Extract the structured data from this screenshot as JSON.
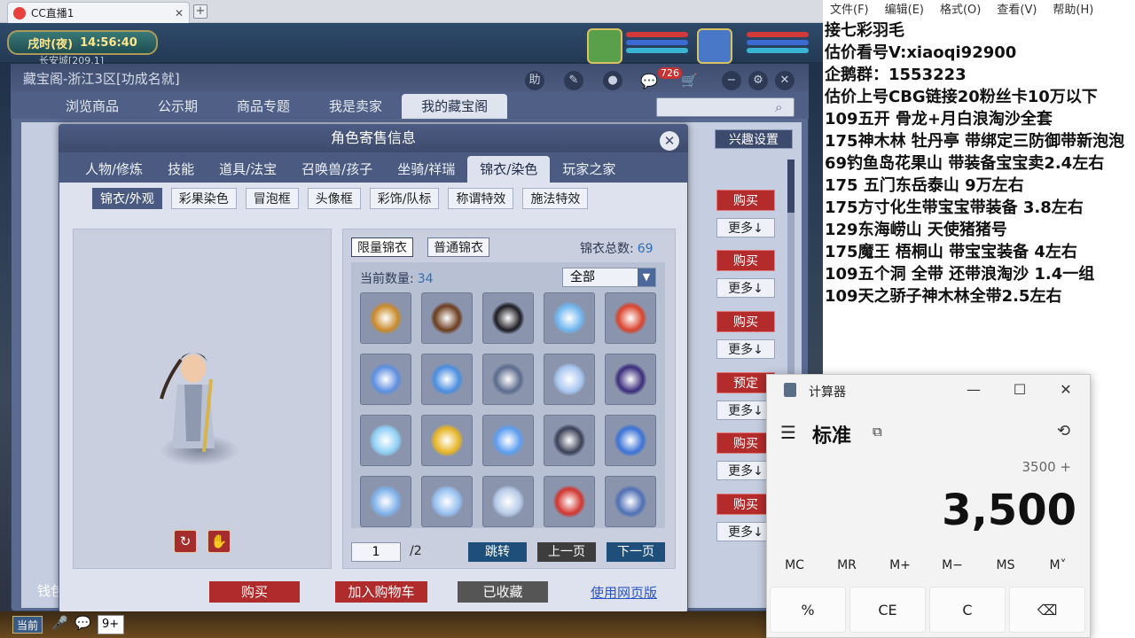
{
  "browser": {
    "tab_title": "CC直播1",
    "tab_close": "✕",
    "new_tab": "+"
  },
  "game": {
    "clock_period": "戌时(夜)",
    "clock_time": "14:56:40",
    "location": "长安城[209,1]",
    "chat_channel": "当前",
    "chat_input": "9+"
  },
  "store": {
    "title": "藏宝阁-浙江3区[功成名就]",
    "toolbar_help": "助",
    "cart_count": "726",
    "nav_tabs": [
      "浏览商品",
      "公示期",
      "商品专题",
      "我是卖家",
      "我的藏宝阁"
    ],
    "active_nav": "我的藏宝阁",
    "interest_label": "兴趣设置",
    "side_buttons": [
      {
        "action": "购买",
        "more": "更多↓"
      },
      {
        "action": "购买",
        "more": "更多↓"
      },
      {
        "action": "购买",
        "more": "更多↓"
      },
      {
        "action": "预定",
        "more": "更多↓"
      },
      {
        "action": "购买",
        "more": "更多↓"
      },
      {
        "action": "购买",
        "more": "更多↓"
      }
    ],
    "wallet_label": "钱包"
  },
  "modal": {
    "title": "角色寄售信息",
    "tabs": [
      "人物/修炼",
      "技能",
      "道具/法宝",
      "召唤兽/孩子",
      "坐骑/祥瑞",
      "锦衣/染色",
      "玩家之家"
    ],
    "active_tab": "锦衣/染色",
    "subtabs": [
      "锦衣/外观",
      "彩果染色",
      "冒泡框",
      "头像框",
      "彩饰/队标",
      "称谓特效",
      "施法特效"
    ],
    "active_subtab": "锦衣/外观",
    "kind_limited": "限量锦衣",
    "kind_normal": "普通锦衣",
    "total_label": "锦衣总数:",
    "total_value": "69",
    "current_label": "当前数量:",
    "current_value": "34",
    "filter_value": "全部",
    "page_current": "1",
    "page_total": "/2",
    "jump_label": "跳转",
    "prev_label": "上一页",
    "next_label": "下一页",
    "buy_label": "购买",
    "cart_label": "加入购物车",
    "fav_label": "已收藏",
    "web_label": "使用网页版",
    "items": [
      {
        "name": "staff-item",
        "color": "#c98a2a"
      },
      {
        "name": "hair-ornament-item",
        "color": "#6b3b1c"
      },
      {
        "name": "black-hair-item",
        "color": "#1b1b22"
      },
      {
        "name": "blue-aura-item",
        "color": "#6fb6ef"
      },
      {
        "name": "red-lantern-item",
        "color": "#d9432b"
      },
      {
        "name": "cloud-item",
        "color": "#5d8fe0"
      },
      {
        "name": "swirl-item",
        "color": "#4a8de0"
      },
      {
        "name": "dark-wing-item",
        "color": "#5b6a8c"
      },
      {
        "name": "ice-crystal-item",
        "color": "#a9c7f0"
      },
      {
        "name": "portrait-card-item",
        "color": "#3a2c7a"
      },
      {
        "name": "ice-wing-item",
        "color": "#8fd0f5"
      },
      {
        "name": "golden-orb-item",
        "color": "#e7b424"
      },
      {
        "name": "sparkle-item",
        "color": "#5d9ef0"
      },
      {
        "name": "dark-rider-item",
        "color": "#3a3f55"
      },
      {
        "name": "blue-ribbon-item",
        "color": "#3a72d6"
      },
      {
        "name": "mist-item",
        "color": "#7fb2ea"
      },
      {
        "name": "nebula-item",
        "color": "#96c0f0"
      },
      {
        "name": "ring-item",
        "color": "#b7cbe8"
      },
      {
        "name": "red-robe-item",
        "color": "#d2352e"
      },
      {
        "name": "blue-armor-item",
        "color": "#4f6fb5"
      }
    ]
  },
  "notepad": {
    "menu": [
      "文件(F)",
      "编辑(E)",
      "格式(O)",
      "查看(V)",
      "帮助(H)"
    ],
    "lines": [
      "  接七彩羽毛",
      "估价看号V:xiaoqi92900",
      "企鹅群：1553223",
      "估价上号CBG链接20粉丝卡10万以下",
      "109五开 骨龙+月白浪淘沙全套",
      "175神木林 牡丹亭  带绑定三防御带新泡泡",
      "69钓鱼岛花果山 带装备宝宝卖2.4左右",
      "175 五门东岳泰山  9万左右",
      "175方寸化生带宝宝带装备  3.8左右",
      "129东海崂山 天使猪猪号",
      "175魔王 梧桐山  带宝宝装备 4左右",
      "109五个洞 全带 还带浪淘沙  1.4一组",
      "109天之骄子神木林全带2.5左右"
    ]
  },
  "calculator": {
    "title": "计算器",
    "mode": "标准",
    "expression": "3500 +",
    "display": "3,500",
    "memory": [
      "MC",
      "MR",
      "M+",
      "M−",
      "MS",
      "M˅"
    ],
    "keys": [
      "%",
      "CE",
      "C",
      "⌫"
    ]
  }
}
